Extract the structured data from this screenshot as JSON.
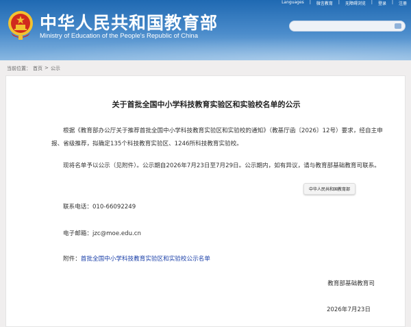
{
  "header": {
    "title": "中华人民共和国教育部",
    "subtitle": "Ministry of Education of the People's Republic of China",
    "top_links": [
      "Languages",
      "|",
      "微言教育",
      "|",
      "无障碍浏览",
      "|",
      "登录",
      "|",
      "注册"
    ],
    "search_placeholder": ""
  },
  "breadcrumb": {
    "prefix": "当前位置：",
    "home": "首页",
    "separator": ">",
    "current": "公示"
  },
  "article": {
    "title": "关于首批全国中小学科技教育实验区和实验校名单的公示",
    "para1": "根据《教育部办公厅关于推荐首批全国中小学科技教育实验区和实验校的通知》（教基厅函〔2026〕12号）要求，经自主申报、省级推荐，拟确定135个科技教育实验区、1246所科技教育实验校。",
    "para2": "现将名单予以公示（见附件）。公示期自2026年7月23日至7月29日。公示期内，如有异议，请与教育部基础教育司联系。",
    "tooltip": "中华人民共和国教育部",
    "phone": "联系电话：010-66092249",
    "email": "电子邮箱：jzc@moe.edu.cn",
    "attachment_prefix": "附件：",
    "attachment_link": "首批全国中小学科技教育实验区和实验校公示名单",
    "signature": "教育部基础教育司",
    "date": "2026年7月23日"
  },
  "colors": {
    "header_top": "#1f69b2",
    "header_bottom": "#89b8e2",
    "link": "#1a3fa8",
    "emblem_red": "#d02a1e",
    "emblem_gold": "#f2c230"
  }
}
